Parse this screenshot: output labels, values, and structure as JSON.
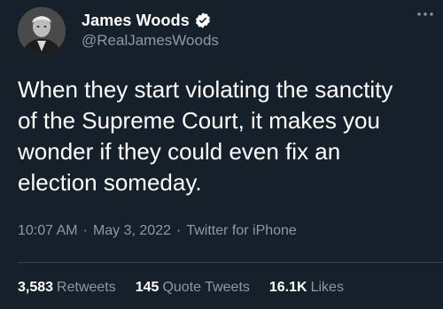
{
  "author": {
    "display_name": "James Woods",
    "handle": "@RealJamesWoods",
    "verified": true,
    "avatar_icon": "profile-photo"
  },
  "tweet": {
    "text": "When they start violating the sanctity\nof the Supreme Court, it makes you\nwonder if they could even fix an\nelection someday.",
    "time": "10:07 AM",
    "separator": "·",
    "date": "May 3, 2022",
    "source": "Twitter for iPhone"
  },
  "stats": {
    "retweets_count": "3,583",
    "retweets_label": "Retweets",
    "quote_tweets_count": "145",
    "quote_tweets_label": "Quote Tweets",
    "likes_count": "16.1K",
    "likes_label": "Likes"
  },
  "colors": {
    "background": "#15202b",
    "primary_text": "#ffffff",
    "secondary_text": "#8b98a5",
    "divider": "#38444d",
    "verified_badge": "#ffffff"
  },
  "icons": {
    "more": "more-dots-icon",
    "verified": "verified-badge-icon"
  }
}
